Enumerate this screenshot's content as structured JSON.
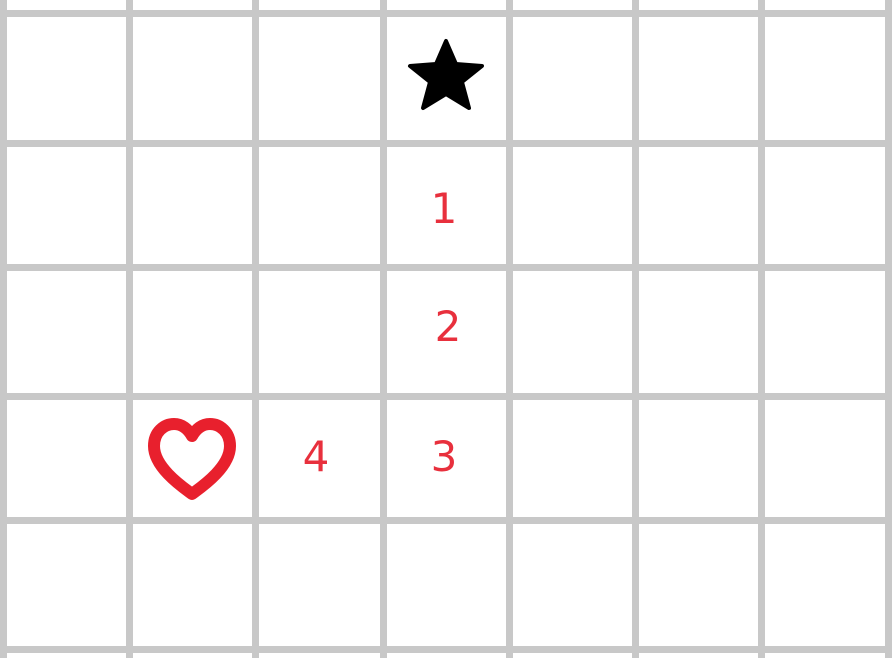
{
  "board": {
    "columns": 7,
    "rows": 5,
    "background_color": "#ffffff",
    "grid_color": "#c8c8c8"
  },
  "pieces": {
    "star": {
      "icon": "star-icon",
      "color": "#000000"
    },
    "heart": {
      "icon": "heart-icon",
      "color": "#e8202d"
    }
  },
  "step_labels": [
    "1",
    "2",
    "3",
    "4"
  ],
  "label_color": "#e8303d"
}
